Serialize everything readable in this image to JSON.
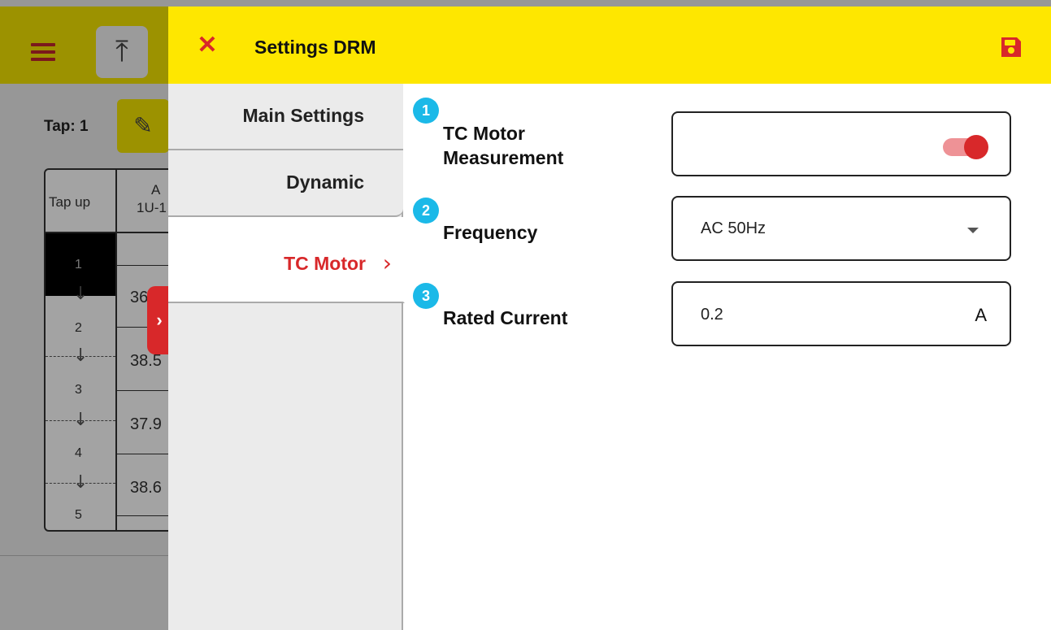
{
  "background": {
    "tap_label": "Tap: 1",
    "table_headers": [
      "Tap up",
      "A",
      "1U-1"
    ],
    "tap_numbers": [
      "1",
      "2",
      "3",
      "4",
      "5"
    ],
    "values": [
      "36",
      "38.5",
      "37.9",
      "38.6"
    ],
    "side_tab_icon": "chevron-right-icon"
  },
  "modal": {
    "title": "Settings DRM",
    "close_icon": "close-icon",
    "save_icon": "save-icon",
    "accent_color": "#d8282a",
    "header_color": "#fee700",
    "nav": [
      {
        "label": "Main Settings"
      },
      {
        "label": "Dynamic"
      },
      {
        "label": "TC Motor",
        "active": true
      }
    ],
    "fields": [
      {
        "badge": "1",
        "label_line1": "TC Motor",
        "label_line2": "Measurement",
        "type": "toggle",
        "on": true
      },
      {
        "badge": "2",
        "label": "Frequency",
        "type": "select",
        "value": "AC 50Hz"
      },
      {
        "badge": "3",
        "label": "Rated Current",
        "type": "number",
        "value": "0.2",
        "unit": "A"
      }
    ]
  }
}
